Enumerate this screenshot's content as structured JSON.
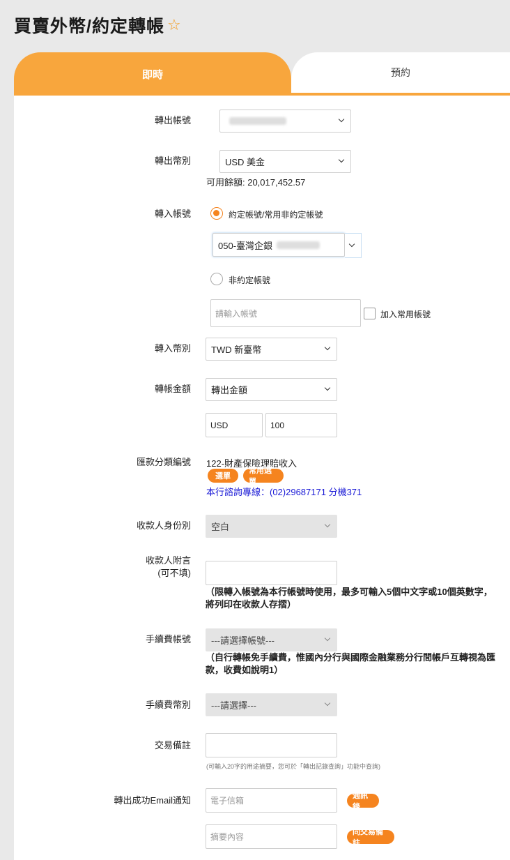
{
  "page": {
    "title": "買賣外幣/約定轉帳",
    "star_icon": "☆"
  },
  "tabs": [
    {
      "label": "即時",
      "active": true
    },
    {
      "label": "預約",
      "active": false
    }
  ],
  "colors": {
    "accent": "#f8a63d",
    "button": "#f5841f",
    "link": "#1a1ad6"
  },
  "form": {
    "from_account": {
      "label": "轉出帳號"
    },
    "from_currency": {
      "label": "轉出幣別",
      "value": "USD 美金",
      "balance": "可用餘額: 20,017,452.57"
    },
    "to_account": {
      "label": "轉入帳號",
      "option_designated": "約定帳號/常用非約定帳號",
      "designated_value": "050-臺灣企銀",
      "option_non_designated": "非約定帳號",
      "input_placeholder": "請輸入帳號",
      "add_common_label": "加入常用帳號"
    },
    "to_currency": {
      "label": "轉入幣別",
      "value": "TWD 新臺幣"
    },
    "amount": {
      "label": "轉帳金額",
      "type_value": "轉出金額",
      "currency": "USD",
      "value": "100"
    },
    "remit_category": {
      "label": "匯款分類編號",
      "value": "122-財產保險理賠收入",
      "btn_select": "選單",
      "btn_common": "常用選單",
      "hotline": "本行諮詢專線：(02)29687171 分機371"
    },
    "payee_identity": {
      "label": "收款人身份別",
      "value": "空白"
    },
    "payee_note": {
      "label": "收款人附言",
      "label_sub": "(可不填)",
      "hint_line1": "（限轉入帳號為本行帳號時使用，最多可輸入5個中文字或10個英數字，",
      "hint_line2": "將列印在收款人存摺）"
    },
    "fee_account": {
      "label": "手續費帳號",
      "value": "---請選擇帳號---",
      "hint_line1": "（自行轉帳免手續費，惟國內分行與國際金融業務分行間帳戶互轉視為匯",
      "hint_line2": "款，收費如說明1）"
    },
    "fee_currency": {
      "label": "手續費幣別",
      "value": "---請選擇---"
    },
    "memo": {
      "label": "交易備註",
      "hint": "(可輸入20字的用途摘要，您可於「轉出記錄查詢」功能中查詢)"
    },
    "email": {
      "label": "轉出成功Email通知",
      "email_placeholder": "電子信箱",
      "btn_contacts": "通訊錄",
      "summary_placeholder": "摘要內容",
      "btn_same_memo": "同交易備註"
    }
  }
}
